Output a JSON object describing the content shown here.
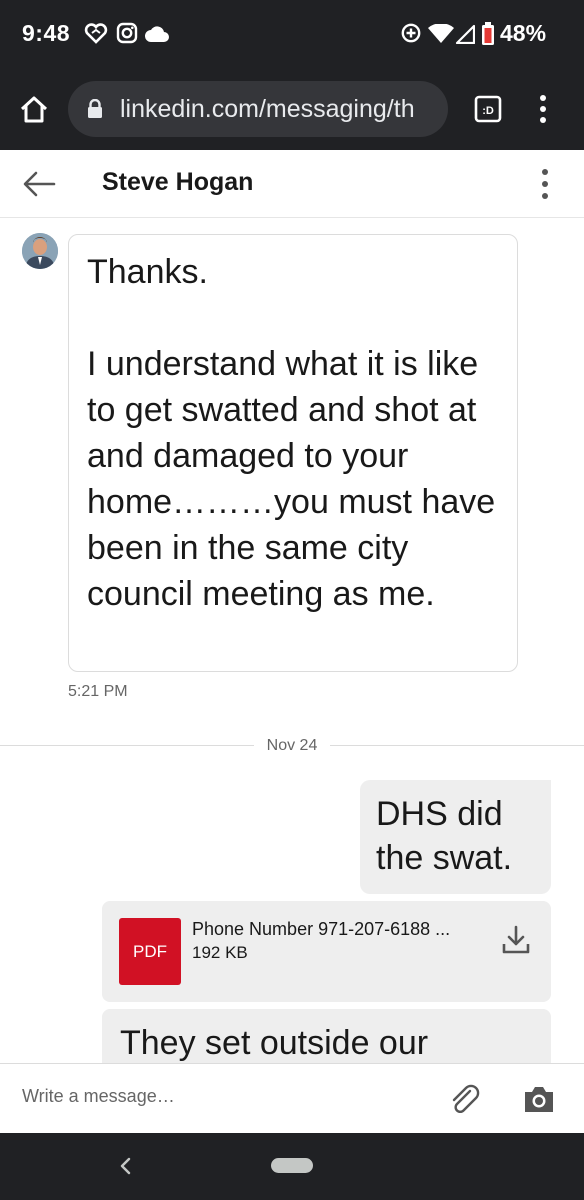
{
  "status_bar": {
    "time": "9:48",
    "battery_percent": "48%",
    "icons": [
      "heart-icon",
      "instagram-icon",
      "cloud-icon",
      "data-saver-icon",
      "wifi-icon",
      "signal-icon",
      "battery-icon"
    ]
  },
  "browser": {
    "url": "linkedin.com/messaging/th",
    "tab_switcher_label": ":D",
    "icons": [
      "home-icon",
      "lock-icon",
      "tab-switcher-icon",
      "more-vert-icon"
    ]
  },
  "conversation": {
    "contact_name": "Steve Hogan",
    "icons": [
      "back-arrow-icon",
      "more-vert-icon"
    ]
  },
  "messages": {
    "incoming": {
      "paragraphs": [
        "Thanks.",
        "I understand what it is like to get swatted and shot at and damaged to your home………you must have been in the same city council meeting as me."
      ],
      "time": "5:21 PM"
    },
    "date_divider": "Nov 24",
    "outgoing_text": "DHS did the swat.",
    "attachment": {
      "type_label": "PDF",
      "file_name": "Phone Number 971-207-6188 ...",
      "file_size": "192 KB"
    },
    "outgoing_text_2": "They set outside our"
  },
  "composer": {
    "placeholder": "Write a message…",
    "icons": [
      "paperclip-icon",
      "camera-icon"
    ]
  },
  "colors": {
    "system_bar": "#202124",
    "url_box": "#35363a",
    "outgoing_bubble": "#eeeeee",
    "pdf_red": "#d11124"
  }
}
